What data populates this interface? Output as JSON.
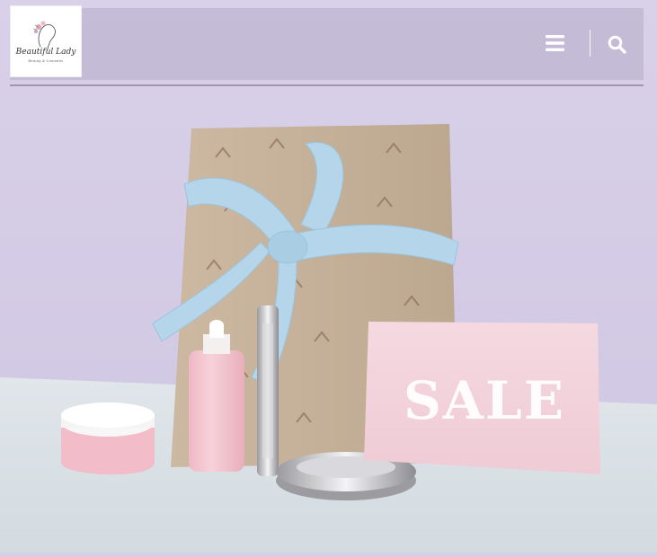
{
  "logo": {
    "name": "Beautiful Lady",
    "tagline": "Beauty & Cosmetic"
  },
  "header": {
    "menu_icon": "hamburger-menu-icon",
    "search_icon": "search-icon"
  },
  "hero": {
    "sale_text": "SALE"
  },
  "colors": {
    "background_top": "#d8d0e8",
    "table": "#dde4e8",
    "gift_box": "#c6b29a",
    "ribbon": "#b7d7ea",
    "sale_card": "#f2d3dc",
    "pink_product": "#f1c2cd"
  }
}
